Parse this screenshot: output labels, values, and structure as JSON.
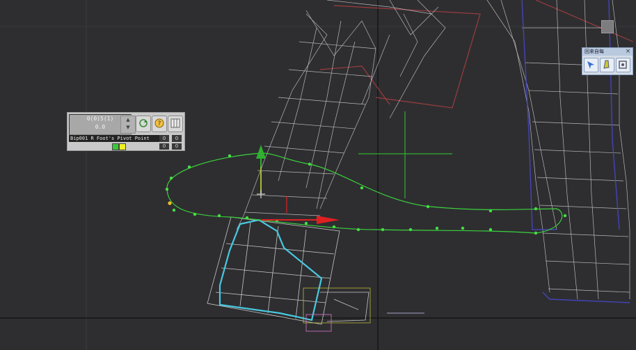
{
  "trackbar": {
    "frame_text": "0(0)5(1)",
    "frame_sub": "0.0",
    "spin_up": "▲",
    "spin_down": "▼",
    "object_name": "Bip001 R Foot's Pivot Point",
    "value_a": "0",
    "value_b": "0",
    "value_c": "0",
    "value_d": "0",
    "key_colors": [
      "#38c838",
      "#f0f020"
    ]
  },
  "float_panel": {
    "title": "回来自每",
    "close_label": "×"
  },
  "colors": {
    "viewport_bg": "#2e2e31",
    "wire": "#c8c8c8",
    "trajectory": "#3bd33b",
    "gizmo_x": "#e02020",
    "gizmo_y": "#2fb02f",
    "selection_cyan": "#49c8e0",
    "red_bone": "#c04040",
    "blue_bone": "#4a4ad0",
    "yellow_box": "#c8c838",
    "pink_box": "#d070c0"
  },
  "icons": [
    "key-icon",
    "redo-icon",
    "help-icon",
    "grid-icon",
    "select-arrow-icon",
    "foot-icon",
    "zoom-extents-icon",
    "viewport-corner-icon"
  ]
}
